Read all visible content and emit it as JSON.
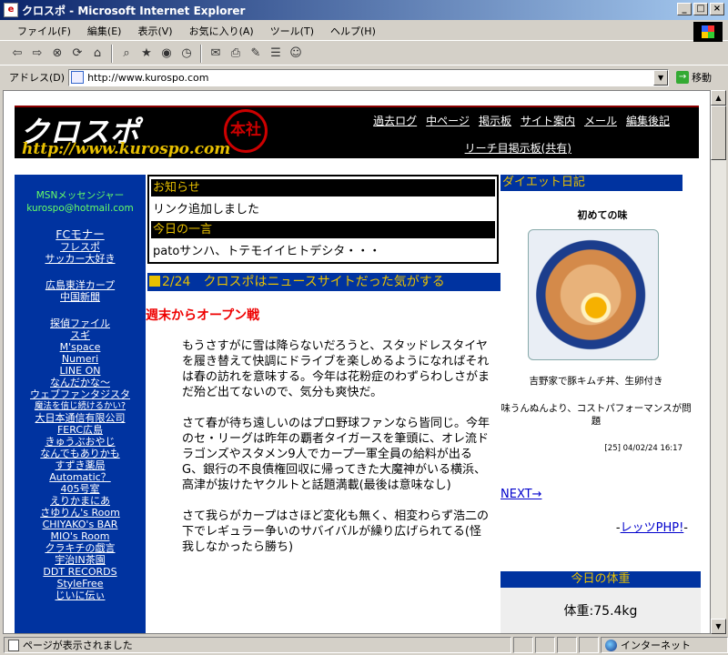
{
  "window": {
    "title": "クロスポ - Microsoft Internet Explorer"
  },
  "menu": [
    "ファイル(F)",
    "編集(E)",
    "表示(V)",
    "お気に入り(A)",
    "ツール(T)",
    "ヘルプ(H)"
  ],
  "address": {
    "label": "アドレス(D)",
    "url": "http://www.kurospo.com",
    "go": "移動"
  },
  "header": {
    "logo": "クロスポ",
    "url": "http://www.kurospo.com",
    "seal": "本社",
    "nav": [
      "過去ログ",
      "中ページ",
      "掲示板",
      "サイト案内",
      "メール",
      "編集後記"
    ],
    "subnav": "リーチ目掲示板(共有)"
  },
  "sidebar": {
    "msn_label": "MSNメッセンジャー",
    "msn_email": "kurospo@hotmail.com",
    "group1": [
      "FCモナー"
    ],
    "group1b": [
      "フレスポ",
      "サッカー大好き"
    ],
    "group2": [
      "広島東洋カープ",
      "中国新聞"
    ],
    "group3": [
      "探偵ファイル",
      "スギ",
      "M'space",
      "Numeri",
      "LINE ON",
      "なんだかな～",
      "ウェブファンタジスタ",
      "魔法を信じ続けるかい?",
      "大日本通信有限公司",
      "FERC広島",
      "きゅうぶおやじ",
      "なんでもありかも",
      "すずき薬局",
      "Automatic？",
      "405号室",
      "えりかまにあ",
      "さゆりん's Room",
      "CHIYAKO's BAR",
      "MIO's Room",
      "クラキチの戯言",
      "宇治IN茶園",
      "DDT RECORDS",
      "StyleFree",
      "じいに伝ぃ"
    ]
  },
  "notice": {
    "h1": "お知らせ",
    "t1": "リンク追加しました",
    "h2": "今日の一言",
    "t2": "patoサンハ、トテモイイヒトデシタ・・・"
  },
  "main": {
    "title": "2/24　クロスポはニュースサイトだった気がする",
    "subhead": "週末からオープン戦",
    "paragraphs": [
      "もうさすがに雪は降らないだろうと、スタッドレスタイヤを履き替えて快調にドライブを楽しめるようになればそれは春の訪れを意味する。今年は花粉症のわずらわしさがまだ殆ど出てないので、気分も爽快だ。",
      "さて春が待ち遠しいのはプロ野球ファンなら皆同じ。今年のセ・リーグは昨年の覇者タイガースを筆頭に、オレ流ドラゴンズやスタメン9人でカープ一軍全員の給料が出るG、銀行の不良債権回収に帰ってきた大魔神がいる横浜、高津が抜けたヤクルトと話題満載(最後は意味なし)",
      "さて我らがカープはさほど変化も無く、相変わらず浩二の下でレギュラー争いのサバイバルが繰り広げられてる(怪我しなかったら勝ち)"
    ]
  },
  "right": {
    "diary_title": "ダイエット日記",
    "caption": "初めての味",
    "photo_text": "吉野家で豚キムチ丼、生卵付き",
    "comment": "味うんぬんより、コストパフォーマンスが問題",
    "meta": "[25] 04/02/24 16:17",
    "next": "NEXT→",
    "php_prefix": "-",
    "php": "レッツPHP!",
    "php_suffix": "-",
    "weight_title": "今日の体重",
    "weight": "体重:75.4kg"
  },
  "status": {
    "text": "ページが表示されました",
    "zone": "インターネット"
  }
}
